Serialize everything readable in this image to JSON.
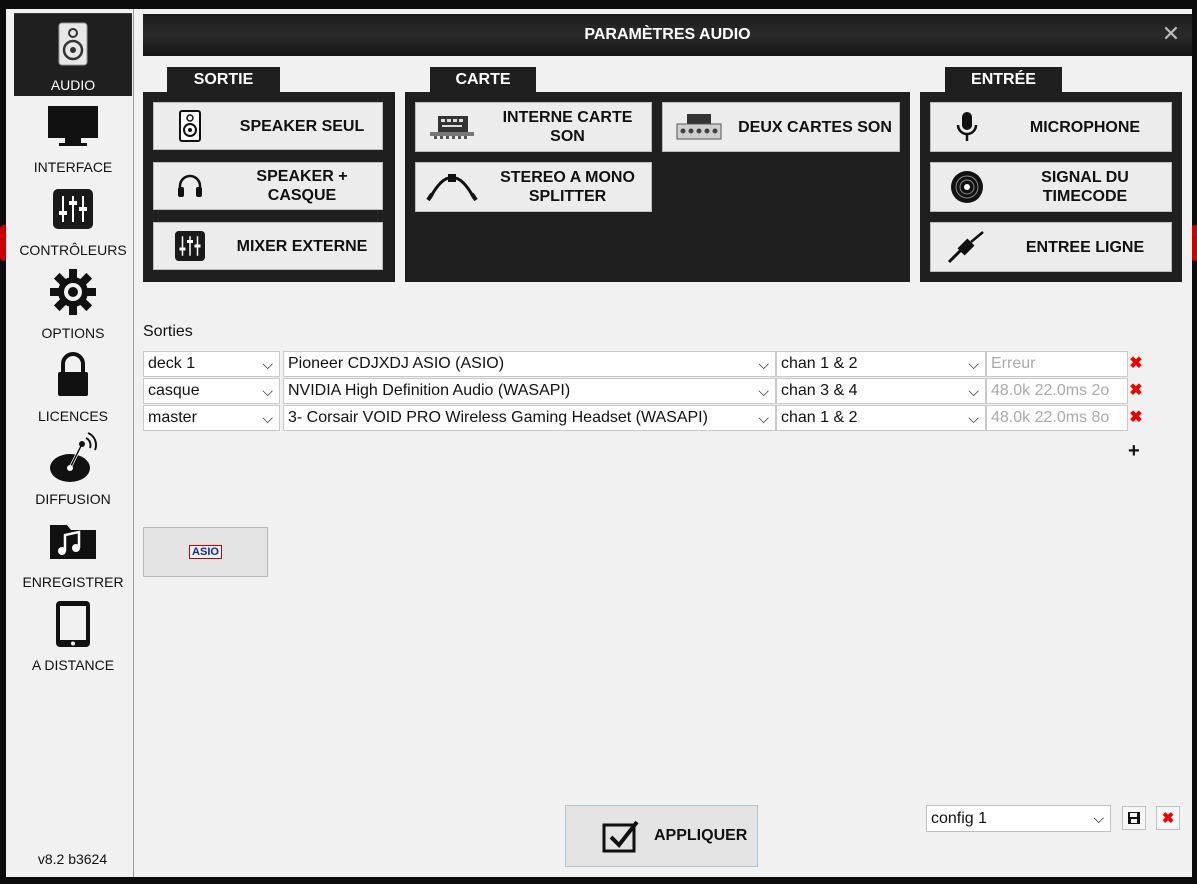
{
  "window": {
    "title": "PARAMÈTRES AUDIO",
    "close_icon": "close-icon"
  },
  "sidebar": {
    "items": [
      {
        "label": "AUDIO",
        "icon": "speaker-icon",
        "active": true
      },
      {
        "label": "INTERFACE",
        "icon": "monitor-icon"
      },
      {
        "label": "CONTRÔLEURS",
        "icon": "sliders-icon"
      },
      {
        "label": "OPTIONS",
        "icon": "gear-icon"
      },
      {
        "label": "LICENCES",
        "icon": "lock-icon"
      },
      {
        "label": "DIFFUSION",
        "icon": "broadcast-icon"
      },
      {
        "label": "ENREGISTRER",
        "icon": "music-folder-icon"
      },
      {
        "label": "A DISTANCE",
        "icon": "tablet-icon"
      }
    ],
    "version": "v8.2 b3624"
  },
  "sortie": {
    "tab": "SORTIE",
    "options": [
      {
        "label": "SPEAKER SEUL",
        "icon": "speaker-icon"
      },
      {
        "label": "SPEAKER + CASQUE",
        "icon": "headphones-icon"
      },
      {
        "label": "MIXER EXTERNE",
        "icon": "sliders-icon"
      }
    ]
  },
  "carte": {
    "tab": "CARTE",
    "options": [
      {
        "label": "INTERNE CARTE SON",
        "icon": "sound-card-icon"
      },
      {
        "label": "DEUX CARTES SON",
        "icon": "audio-interface-icon"
      },
      {
        "label": "STEREO A MONO SPLITTER",
        "icon": "splitter-cable-icon"
      }
    ]
  },
  "entree": {
    "tab": "ENTRÉE",
    "options": [
      {
        "label": "MICROPHONE",
        "icon": "microphone-icon"
      },
      {
        "label": "SIGNAL DU TIMECODE",
        "icon": "vinyl-icon"
      },
      {
        "label": "ENTREE LIGNE",
        "icon": "jack-cable-icon"
      }
    ]
  },
  "sorties": {
    "label": "Sorties",
    "rows": [
      {
        "target": "deck 1",
        "device": "Pioneer CDJXDJ ASIO (ASIO)",
        "channels": "chan 1 & 2",
        "info": "Erreur"
      },
      {
        "target": "casque",
        "device": "NVIDIA High Definition Audio (WASAPI)",
        "channels": "chan 3 & 4",
        "info": "48.0k 22.0ms 2o"
      },
      {
        "target": "master",
        "device": "3- Corsair VOID PRO Wireless Gaming Headset (WASAPI)",
        "channels": "chan 1 & 2",
        "info": "48.0k 22.0ms 8o"
      }
    ],
    "add_label": "+"
  },
  "asio_button": {
    "label": "ASIO"
  },
  "apply_button": {
    "label": "APPLIQUER",
    "icon": "checkbox-check-icon"
  },
  "config": {
    "value": "config 1",
    "save_icon": "save-icon",
    "delete_icon": "delete-icon"
  },
  "colors": {
    "header": "#1f1f1f",
    "accent_red": "#e00000",
    "panel": "#1f1f1f"
  }
}
